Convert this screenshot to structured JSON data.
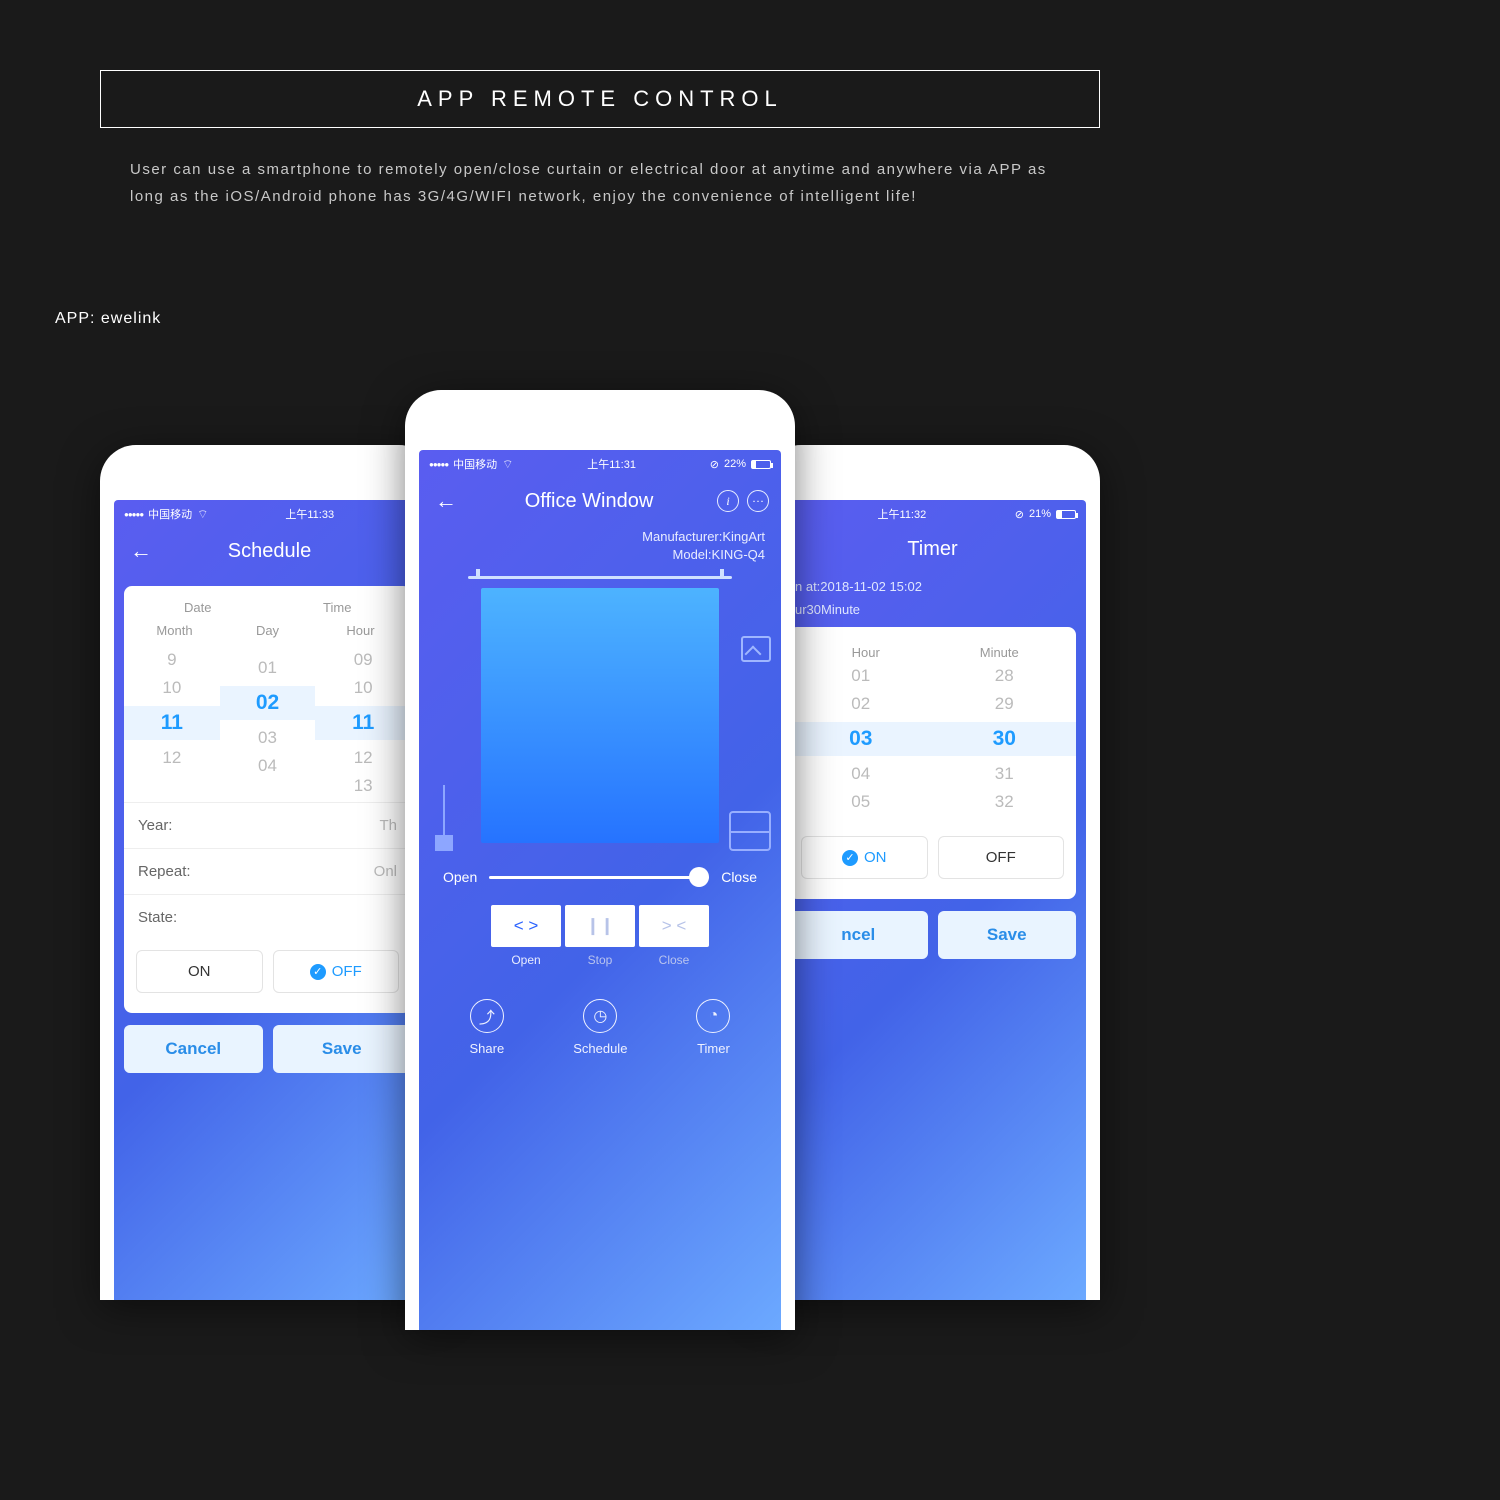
{
  "banner": {
    "title": "APP REMOTE CONTROL"
  },
  "description": "User can use a smartphone to remotely open/close curtain or electrical door at anytime and anywhere via APP as long as the iOS/Android phone has 3G/4G/WIFI network, enjoy the convenience of intelligent life!",
  "app_label": "APP: ewelink",
  "left": {
    "status": {
      "carrier": "中国移动",
      "time": "上午11:33"
    },
    "title": "Schedule",
    "tabs": {
      "date": "Date",
      "time": "Time"
    },
    "cols": {
      "month": "Month",
      "day": "Day",
      "hour": "Hour"
    },
    "picker": {
      "month": [
        "9",
        "10",
        "11",
        "12",
        ""
      ],
      "day": [
        "",
        "01",
        "02",
        "03",
        "04"
      ],
      "hour": [
        "09",
        "10",
        "11",
        "12",
        "13"
      ],
      "selected_index": 2
    },
    "rows": {
      "year_label": "Year:",
      "year_value": "Th",
      "repeat_label": "Repeat:",
      "repeat_value": "Onl",
      "state_label": "State:"
    },
    "toggle": {
      "on": "ON",
      "off": "OFF",
      "active": "off"
    },
    "footer": {
      "cancel": "Cancel",
      "save": "Save"
    }
  },
  "center": {
    "status": {
      "carrier": "中国移动",
      "time": "上午11:31",
      "battery": "22%"
    },
    "title": "Office Window",
    "manufacturer_label": "Manufacturer:KingArt",
    "model_label": "Model:KING-Q4",
    "slider": {
      "open": "Open",
      "close": "Close",
      "value": 100
    },
    "controls": {
      "open": "Open",
      "stop": "Stop",
      "close": "Close"
    },
    "nav": {
      "share": "Share",
      "schedule": "Schedule",
      "timer": "Timer"
    }
  },
  "right": {
    "status": {
      "carrier": "",
      "time": "上午11:32",
      "battery": "21%"
    },
    "title": "Timer",
    "run_at": "n at:2018-11-02 15:02",
    "duration": "ur30Minute",
    "cols": {
      "hour": "Hour",
      "minute": "Minute"
    },
    "picker": {
      "hour": [
        "01",
        "02",
        "03",
        "04",
        "05"
      ],
      "minute": [
        "28",
        "29",
        "30",
        "31",
        "32"
      ],
      "selected_index": 2
    },
    "toggle": {
      "on": "ON",
      "off": "OFF",
      "active": "on"
    },
    "footer": {
      "cancel": "ncel",
      "save": "Save"
    }
  }
}
